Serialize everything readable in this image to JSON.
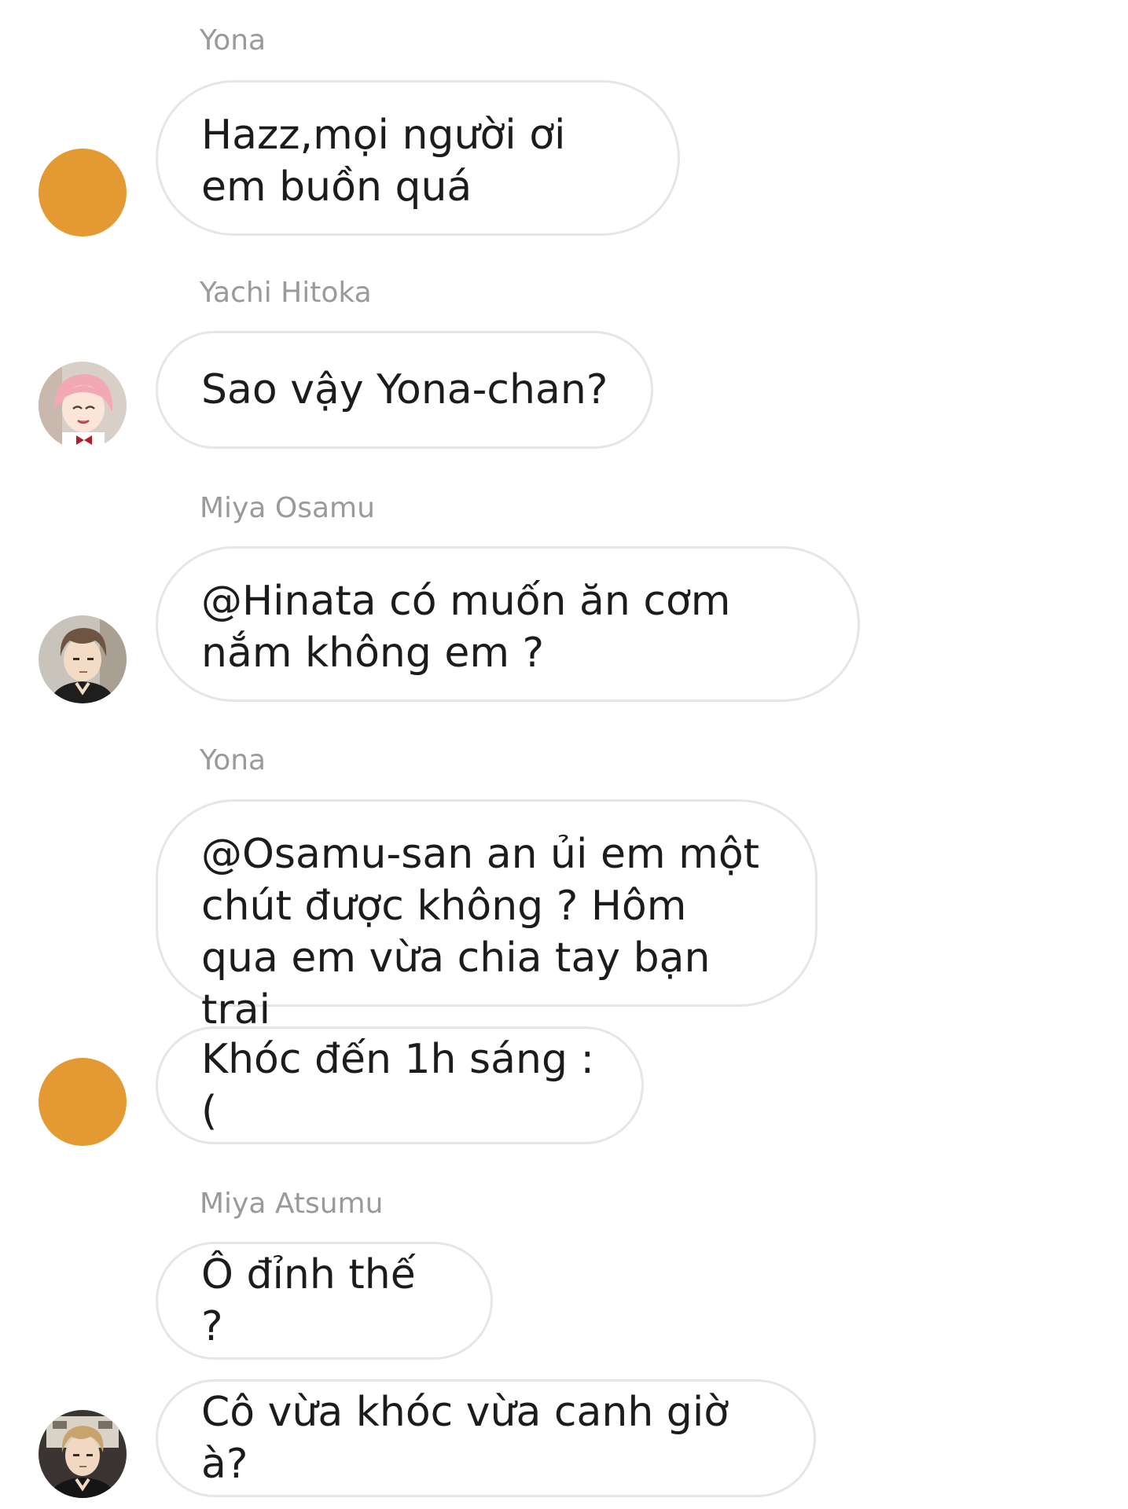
{
  "chat": {
    "colors": {
      "default_avatar": "#e39a33",
      "bubble_border": "#e6e6e6",
      "sender_name": "#9a9a9a"
    },
    "messages": [
      {
        "sender": "Yona",
        "text": "Hazz,mọi người ơi em buồn quá",
        "avatar": "default-orange-avatar"
      },
      {
        "sender": "Yachi Hitoka",
        "text": "Sao vậy Yona-chan?",
        "avatar": "pink-hair-character-avatar"
      },
      {
        "sender": "Miya Osamu",
        "text": "@Hinata có muốn ăn cơm nắm không em ?",
        "avatar": "brown-hair-character-avatar"
      },
      {
        "sender": "Yona",
        "text": "@Osamu-san an ủi em một chút được không ? Hôm qua em vừa chia tay bạn trai"
      },
      {
        "text": "Khóc đến 1h sáng :(",
        "avatar": "default-orange-avatar"
      },
      {
        "sender": "Miya Atsumu",
        "text": "Ô đỉnh thế ?"
      },
      {
        "text": "Cô vừa khóc vừa canh giờ à?",
        "avatar": "blond-hair-character-avatar"
      }
    ]
  }
}
